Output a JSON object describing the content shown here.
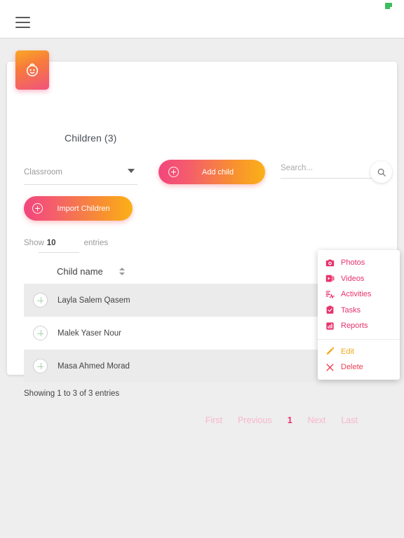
{
  "topbar": {
    "menu_icon": "hamburger-icon",
    "status_chip_color": "#3cbd5e"
  },
  "card": {
    "avatar_icon": "child-face-icon",
    "title": "Children (3)",
    "accent_gradient_start": "#f2467e",
    "accent_gradient_end": "#fbb117"
  },
  "filters": {
    "classroom": {
      "label": "Classroom",
      "value": "",
      "caret_icon": "chevron-down-icon"
    },
    "add_child_label": "Add child",
    "import_children_label": "Import Children",
    "search": {
      "placeholder": "Search...",
      "value": "",
      "icon": "search-icon"
    }
  },
  "table_controls": {
    "show_label": "Show",
    "page_size": "10",
    "entries_label": "entries"
  },
  "table": {
    "columns": [
      {
        "label": "Child name",
        "sortable": true,
        "sort_icon": "sort-arrows-icon"
      }
    ],
    "rows": [
      {
        "expand_icon": "plus-circle-icon",
        "name": "Layla Salem Qasem",
        "menu_icon": "kebab-menu-icon"
      },
      {
        "expand_icon": "plus-circle-icon",
        "name": "Malek Yaser Nour",
        "menu_icon": "kebab-menu-icon"
      },
      {
        "expand_icon": "plus-circle-icon",
        "name": "Masa Ahmed Morad",
        "menu_icon": "kebab-menu-icon"
      }
    ]
  },
  "footer": {
    "showing_text": "Showing 1 to 3 of 3 entries",
    "pagination": {
      "first": "First",
      "previous": "Previous",
      "current": "1",
      "next": "Next",
      "last": "Last"
    }
  },
  "context_menu": {
    "primary_color": "#e8326b",
    "items": [
      {
        "label": "Photos",
        "icon": "camera-icon"
      },
      {
        "label": "Videos",
        "icon": "video-play-icon"
      },
      {
        "label": "Activities",
        "icon": "activities-icon"
      },
      {
        "label": "Tasks",
        "icon": "clipboard-check-icon"
      },
      {
        "label": "Reports",
        "icon": "bar-chart-icon"
      }
    ],
    "secondary_items": [
      {
        "label": "Edit",
        "icon": "pencil-icon",
        "color": "#f0a91e"
      },
      {
        "label": "Delete",
        "icon": "close-x-icon",
        "color": "#ef4154"
      }
    ]
  }
}
